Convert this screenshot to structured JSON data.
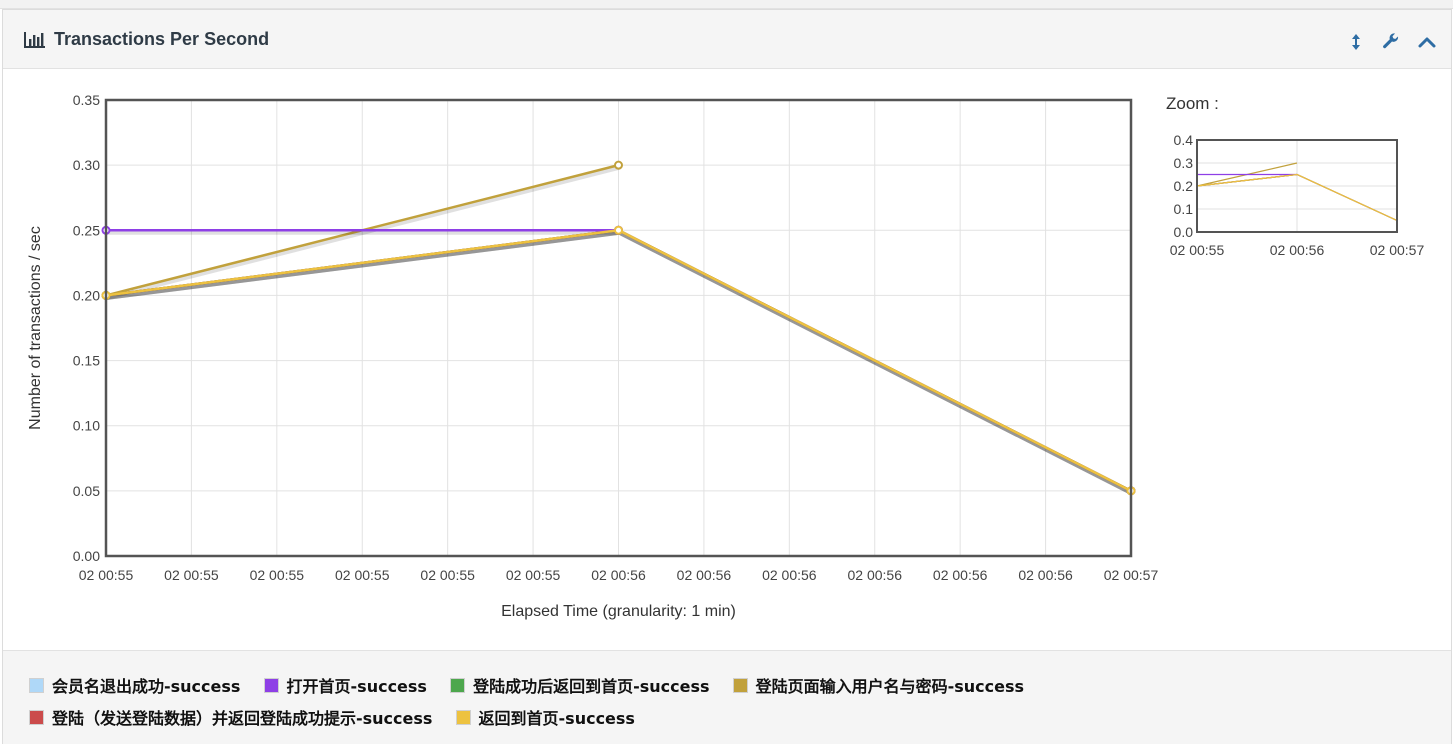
{
  "panel": {
    "title": "Transactions Per Second",
    "icons": {
      "title": "bar-chart-icon",
      "resize": "resize-vertical-icon",
      "settings": "wrench-icon",
      "collapse": "chevron-up-icon"
    }
  },
  "zoom": {
    "label": "Zoom :"
  },
  "chart_data": [
    {
      "type": "line",
      "xlabel": "Elapsed Time (granularity: 1 min)",
      "ylabel": "Number of transactions / sec",
      "ylim": [
        0,
        0.35
      ],
      "yticks": [
        "0.00",
        "0.05",
        "0.10",
        "0.15",
        "0.20",
        "0.25",
        "0.30",
        "0.35"
      ],
      "x_tick_labels": [
        "02 00:55",
        "02 00:55",
        "02 00:55",
        "02 00:55",
        "02 00:55",
        "02 00:55",
        "02 00:56",
        "02 00:56",
        "02 00:56",
        "02 00:56",
        "02 00:56",
        "02 00:56",
        "02 00:57"
      ],
      "x": [
        "02 00:55",
        "02 00:56",
        "02 00:57"
      ],
      "grid": true,
      "legend_placement": "bottom",
      "series": [
        {
          "name": "会员名退出成功-success",
          "color": "#afd8f8",
          "values": [
            0.2,
            0.25,
            0.05
          ]
        },
        {
          "name": "打开首页-success",
          "color": "#8e3fe6",
          "values": [
            0.25,
            0.25,
            null
          ]
        },
        {
          "name": "登陆成功后返回到首页-success",
          "color": "#4da74d",
          "values": [
            0.2,
            0.25,
            0.05
          ]
        },
        {
          "name": "登陆页面输入用户名与密码-success",
          "color": "#c1a13c",
          "values": [
            0.2,
            0.3,
            null
          ]
        },
        {
          "name": "登陆（发送登陆数据）并返回登陆成功提示-success",
          "color": "#cb4b4b",
          "values": [
            0.2,
            0.25,
            0.05
          ]
        },
        {
          "name": "返回到首页-success",
          "color": "#edc240",
          "values": [
            0.2,
            0.25,
            0.05
          ]
        }
      ]
    },
    {
      "type": "line",
      "title": "Zoom :",
      "ylim": [
        0,
        0.4
      ],
      "yticks": [
        "0.0",
        "0.1",
        "0.2",
        "0.3",
        "0.4"
      ],
      "x_tick_labels": [
        "02 00:55",
        "02 00:56",
        "02 00:57"
      ],
      "x": [
        "02 00:55",
        "02 00:56",
        "02 00:57"
      ],
      "grid": true
    }
  ]
}
